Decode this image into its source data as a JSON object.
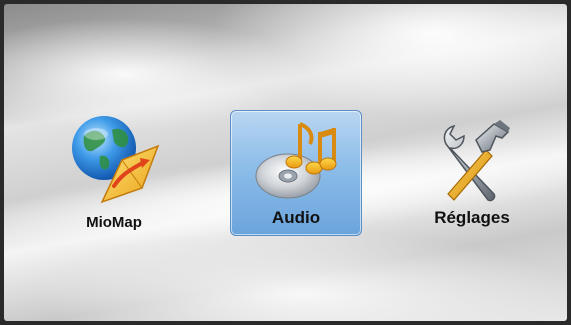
{
  "screen": "Main menu",
  "menu": {
    "items": [
      {
        "label": "MioMap",
        "icon": "globe-map-icon",
        "selected": false
      },
      {
        "label": "Audio",
        "icon": "cd-music-icon",
        "selected": true
      },
      {
        "label": "Réglages",
        "icon": "tools-icon",
        "selected": false
      }
    ]
  },
  "colors": {
    "selection_top": "#b9d6f2",
    "selection_bottom": "#6aa4dc",
    "selection_border": "#5b8fc4",
    "label": "#111111"
  }
}
